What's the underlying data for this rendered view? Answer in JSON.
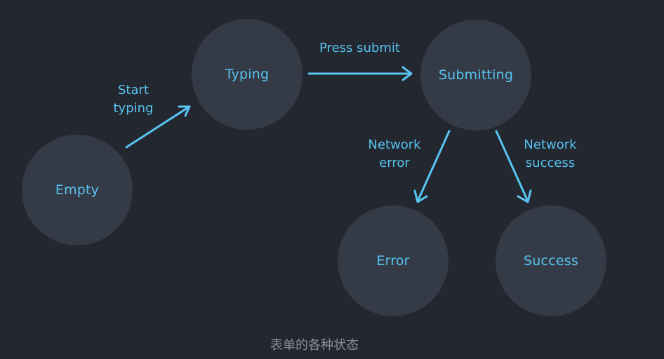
{
  "diagram": {
    "states": {
      "empty": "Empty",
      "typing": "Typing",
      "submitting": "Submitting",
      "error": "Error",
      "success": "Success"
    },
    "transitions": {
      "start_typing": [
        "Start",
        "typing"
      ],
      "press_submit": "Press submit",
      "network_error": [
        "Network",
        "error"
      ],
      "network_success": [
        "Network",
        "success"
      ]
    }
  },
  "caption": "表单的各种状态",
  "colors": {
    "background": "#23272f",
    "node": "#343a46",
    "accent": "#58c4f2",
    "caption": "#8a8f98"
  }
}
